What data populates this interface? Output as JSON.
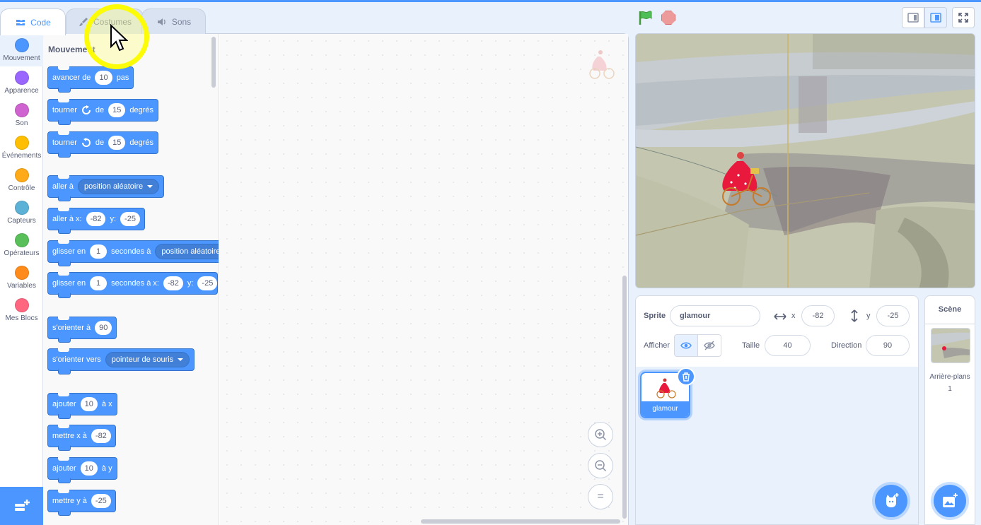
{
  "tabs": {
    "code": "Code",
    "costumes": "Costumes",
    "sounds": "Sons"
  },
  "categories": [
    {
      "label": "Mouvement",
      "color": "#4c97ff"
    },
    {
      "label": "Apparence",
      "color": "#9966ff"
    },
    {
      "label": "Son",
      "color": "#cf63cf"
    },
    {
      "label": "Événements",
      "color": "#ffbf00"
    },
    {
      "label": "Contrôle",
      "color": "#ffab19"
    },
    {
      "label": "Capteurs",
      "color": "#5cb1d6"
    },
    {
      "label": "Opérateurs",
      "color": "#59c059"
    },
    {
      "label": "Variables",
      "color": "#ff8c1a"
    },
    {
      "label": "Mes Blocs",
      "color": "#ff6680"
    }
  ],
  "palette": {
    "title": "Mouvement",
    "blocks": {
      "move": {
        "t1": "avancer de",
        "v1": "10",
        "t2": "pas"
      },
      "turn_right": {
        "t1": "tourner",
        "t2": "de",
        "v1": "15",
        "t3": "degrés"
      },
      "turn_left": {
        "t1": "tourner",
        "t2": "de",
        "v1": "15",
        "t3": "degrés"
      },
      "goto": {
        "t1": "aller à",
        "dd": "position aléatoire"
      },
      "goto_xy": {
        "t1": "aller à x:",
        "v1": "-82",
        "t2": "y:",
        "v2": "-25"
      },
      "glide_to": {
        "t1": "glisser en",
        "v1": "1",
        "t2": "secondes à",
        "dd": "position aléatoire"
      },
      "glide_xy": {
        "t1": "glisser en",
        "v1": "1",
        "t2": "secondes à x:",
        "v2": "-82",
        "t3": "y:",
        "v3": "-25"
      },
      "point_dir": {
        "t1": "s'orienter à",
        "v1": "90"
      },
      "point_towards": {
        "t1": "s'orienter vers",
        "dd": "pointeur de souris"
      },
      "change_x": {
        "t1": "ajouter",
        "v1": "10",
        "t2": "à x"
      },
      "set_x": {
        "t1": "mettre x à",
        "v1": "-82"
      },
      "change_y": {
        "t1": "ajouter",
        "v1": "10",
        "t2": "à y"
      },
      "set_y": {
        "t1": "mettre y à",
        "v1": "-25"
      }
    }
  },
  "zoom_controls": {
    "reset_label": "="
  },
  "sprite_info": {
    "sprite_label": "Sprite",
    "sprite_name": "glamour",
    "x_label": "x",
    "x_value": "-82",
    "y_label": "y",
    "y_value": "-25",
    "show_label": "Afficher",
    "size_label": "Taille",
    "size_value": "40",
    "direction_label": "Direction",
    "direction_value": "90"
  },
  "sprites": [
    {
      "name": "glamour"
    }
  ],
  "stage_pane": {
    "title": "Scène",
    "backdrops_label": "Arrière-plans",
    "backdrops_count": "1"
  }
}
